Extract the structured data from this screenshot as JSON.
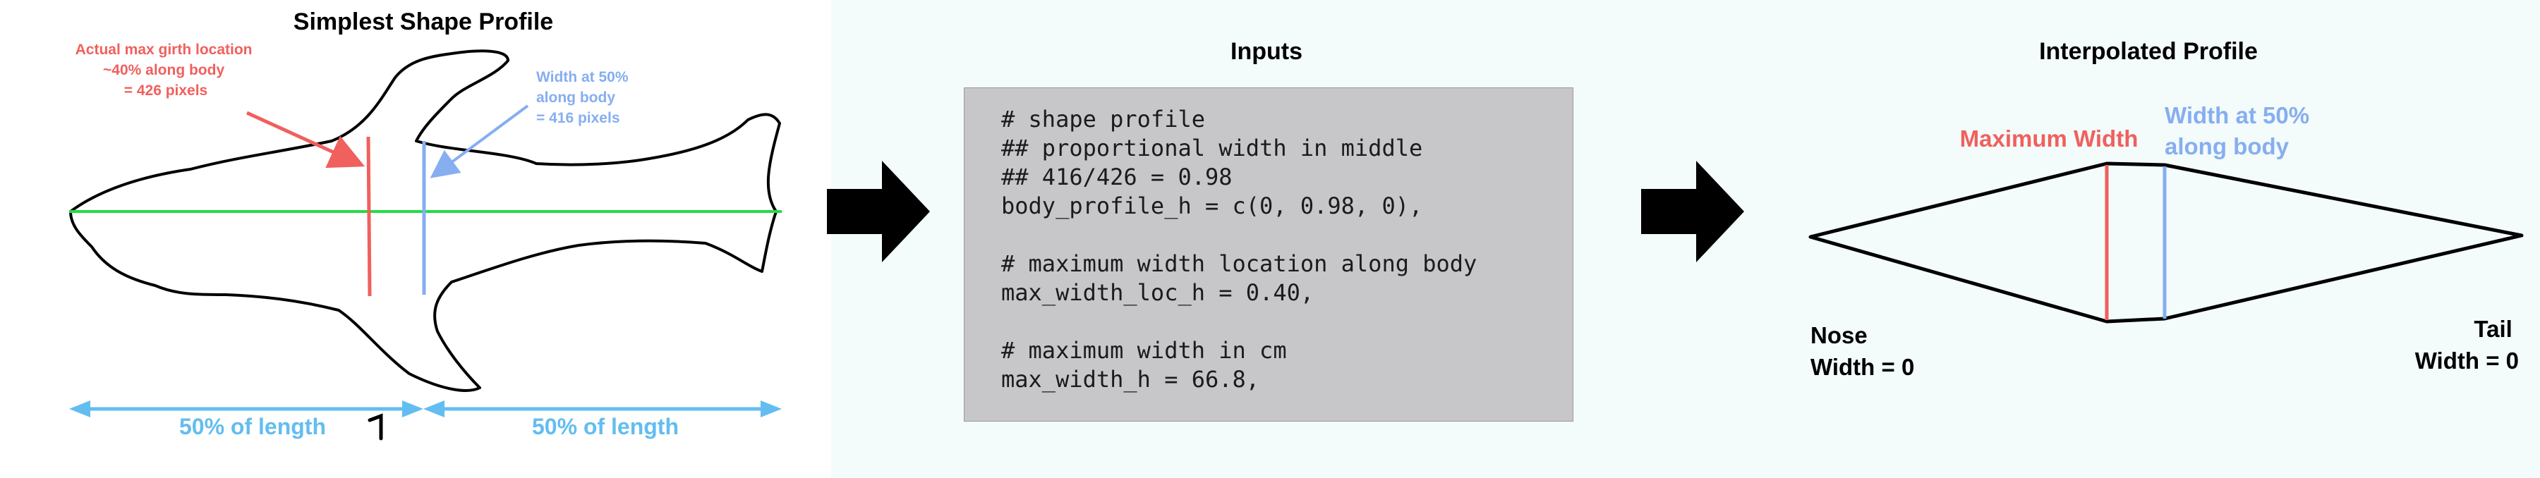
{
  "left_panel": {
    "title": "Simplest Shape Profile",
    "red_annotation": [
      "Actual max girth location",
      "~40% along body",
      "= 426 pixels"
    ],
    "blue_annotation": [
      "Width at 50%",
      "along body",
      "= 416 pixels"
    ],
    "left_half_label": "50% of length",
    "right_half_label": "50% of length"
  },
  "middle_panel": {
    "title": "Inputs",
    "code_lines": [
      "# shape profile",
      "## proportional width in middle",
      "## 416/426 = 0.98",
      "body_profile_h = c(0, 0.98, 0),",
      "",
      "# maximum width location along body",
      "max_width_loc_h = 0.40,",
      "",
      "# maximum width in cm",
      "max_width_h = 66.8,"
    ]
  },
  "right_panel": {
    "title": "Interpolated Profile",
    "max_width_label": "Maximum Width",
    "width50_label": [
      "Width at 50%",
      "along body"
    ],
    "nose_label": [
      "Nose",
      "Width = 0"
    ],
    "tail_label": [
      "Tail",
      "Width = 0"
    ]
  },
  "colors": {
    "red": "#f0605d",
    "blue": "#86aef0",
    "sky": "#63bdf0",
    "green": "#22dd44",
    "arrow": "#000000",
    "code_bg": "#c7c6c9"
  },
  "icons": [
    "arrow-right-icon",
    "arrow-right-icon"
  ]
}
